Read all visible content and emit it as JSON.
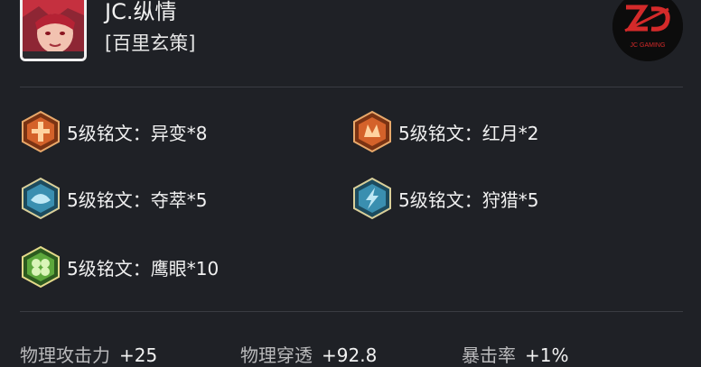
{
  "player": {
    "name": "JC.纵情",
    "hero": "[百里玄策]",
    "team_logo_text": "JC GAMING"
  },
  "runes": [
    {
      "label": "5级铭文：异变*8",
      "icon": "rune-yibian-icon",
      "color": "#d4622a"
    },
    {
      "label": "5级铭文：红月*2",
      "icon": "rune-hongyue-icon",
      "color": "#d4622a"
    },
    {
      "label": "5级铭文：夺萃*5",
      "icon": "rune-duocui-icon",
      "color": "#3a8fb0"
    },
    {
      "label": "5级铭文：狩猎*5",
      "icon": "rune-shoulie-icon",
      "color": "#3a8fb0"
    },
    {
      "label": "5级铭文：鹰眼*10",
      "icon": "rune-yingyan-icon",
      "color": "#5da83c"
    }
  ],
  "stats": [
    {
      "label": "物理攻击力",
      "value": "+25"
    },
    {
      "label": "物理穿透",
      "value": "+92.8"
    },
    {
      "label": "暴击率",
      "value": "+1%"
    }
  ]
}
